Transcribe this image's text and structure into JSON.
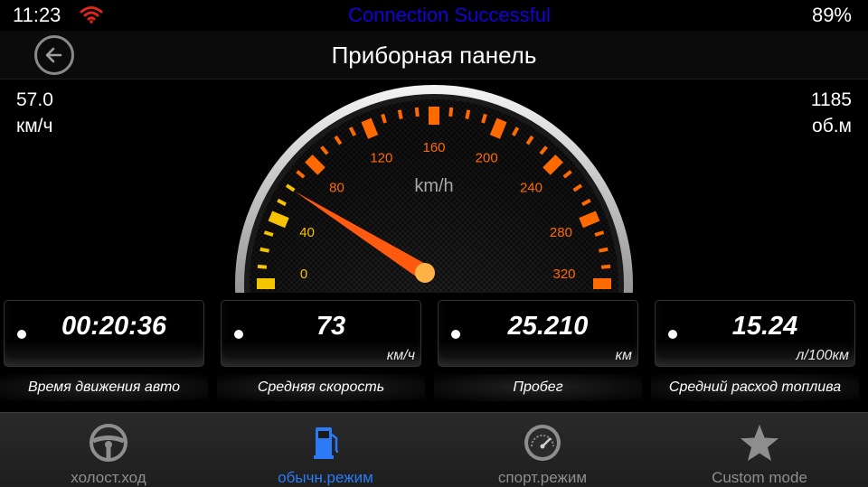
{
  "status_bar": {
    "time": "11:23",
    "connection_message": "Connection Successful",
    "battery": "89%"
  },
  "header": {
    "title": "Приборная панель"
  },
  "readouts": {
    "speed_value": "57.0",
    "speed_unit": "км/ч",
    "rpm_value": "1185",
    "rpm_unit": "об.м"
  },
  "gauge": {
    "unit_label": "km/h",
    "min": 0,
    "max": 320,
    "tick_labels": [
      "0",
      "40",
      "80",
      "120",
      "160",
      "200",
      "240",
      "280",
      "320"
    ],
    "needle_value": 57,
    "colors": {
      "low": "#f5c400",
      "high": "#ff6a00",
      "needle": "#ff5a10"
    }
  },
  "stats": [
    {
      "value": "00:20:36",
      "unit": "",
      "label": "Время движения авто"
    },
    {
      "value": "73",
      "unit": "км/ч",
      "label": "Средняя скорость"
    },
    {
      "value": "25.210",
      "unit": "км",
      "label": "Пробег"
    },
    {
      "value": "15.24",
      "unit": "л/100км",
      "label": "Средний расход топлива"
    }
  ],
  "tabs": [
    {
      "label": "холост.ход",
      "icon": "steering-wheel-icon",
      "active": false
    },
    {
      "label": "обычн.режим",
      "icon": "fuel-pump-icon",
      "active": true
    },
    {
      "label": "спорт.режим",
      "icon": "speedometer-icon",
      "active": false
    },
    {
      "label": "Custom mode",
      "icon": "star-icon",
      "active": false
    }
  ],
  "colors": {
    "accent": "#2a7bf5",
    "status_message": "#1500d8",
    "wifi": "#e0261b"
  }
}
